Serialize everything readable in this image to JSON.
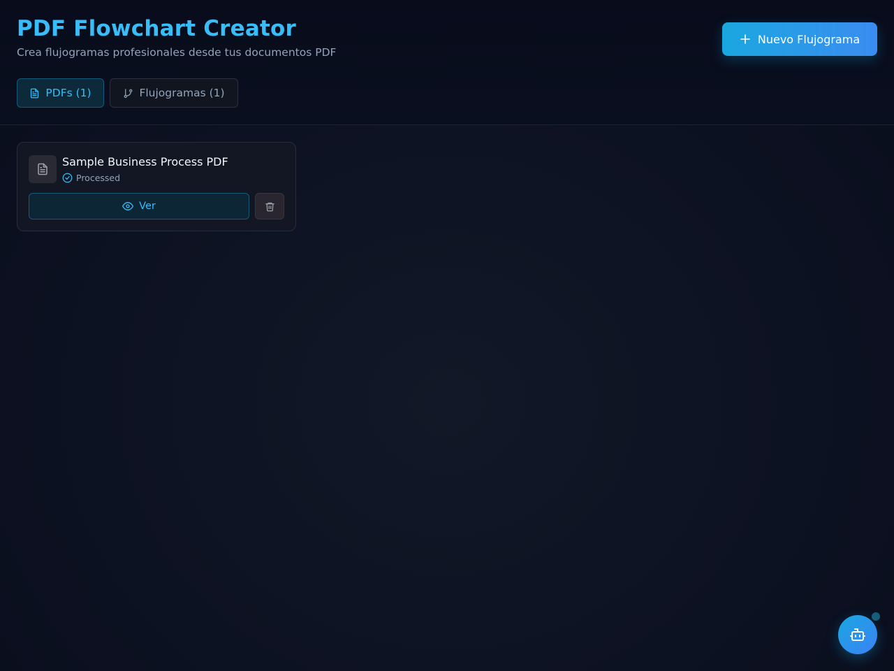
{
  "header": {
    "title": "PDF Flowchart Creator",
    "subtitle": "Crea flujogramas profesionales desde tus documentos PDF",
    "new_button_label": "Nuevo Flujograma",
    "new_button_icon": "plus-icon"
  },
  "tabs": [
    {
      "label": "PDFs (1)",
      "icon": "file-text-icon",
      "active": true
    },
    {
      "label": "Flujogramas (1)",
      "icon": "git-branch-icon",
      "active": false
    }
  ],
  "pdf_list": [
    {
      "name": "Sample Business Process PDF",
      "status": "Processed",
      "status_icon": "check-circle-icon",
      "view_label": "Ver",
      "view_icon": "eye-icon",
      "delete_icon": "trash-icon"
    }
  ],
  "assistant": {
    "icon": "bot-icon"
  },
  "colors": {
    "accent": "#38bdf8",
    "background": "#0d1222",
    "card": "#121723",
    "muted_text": "#94a3b8"
  }
}
